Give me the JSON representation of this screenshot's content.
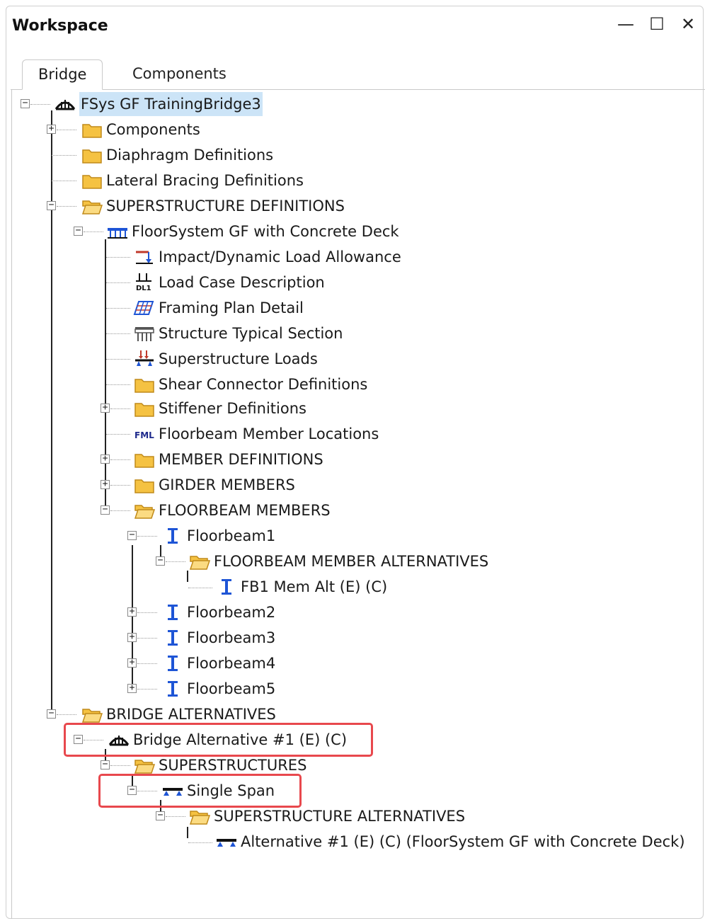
{
  "window": {
    "title": "Workspace",
    "minimize": "—",
    "maximize": "☐",
    "close": "✕"
  },
  "tabs": {
    "bridge": "Bridge",
    "components": "Components"
  },
  "tree": {
    "root": "FSys GF TrainingBridge3",
    "components": "Components",
    "diaphragm": "Diaphragm Definitions",
    "lateral": "Lateral Bracing Definitions",
    "superstructure_defs": "SUPERSTRUCTURE DEFINITIONS",
    "floorsystem": "FloorSystem GF with Concrete Deck",
    "impact": "Impact/Dynamic Load Allowance",
    "loadcase": "Load Case Description",
    "loadcase_icon_text": "DL1",
    "framing": "Framing Plan Detail",
    "typical": "Structure Typical Section",
    "superloads": "Superstructure Loads",
    "shear": "Shear Connector Definitions",
    "stiffener": "Stiffener Definitions",
    "fml_icon_text": "FML",
    "floorbeam_locations": "Floorbeam Member Locations",
    "member_defs": "MEMBER DEFINITIONS",
    "girder_members": "GIRDER MEMBERS",
    "floorbeam_members": "FLOORBEAM MEMBERS",
    "floorbeam1": "Floorbeam1",
    "fb_member_alts": "FLOORBEAM MEMBER ALTERNATIVES",
    "fb1_alt": "FB1 Mem Alt (E)  (C)",
    "floorbeam2": "Floorbeam2",
    "floorbeam3": "Floorbeam3",
    "floorbeam4": "Floorbeam4",
    "floorbeam5": "Floorbeam5",
    "bridge_alts": "BRIDGE ALTERNATIVES",
    "bridge_alt1": "Bridge Alternative #1 (E)  (C)",
    "superstructures": "SUPERSTRUCTURES",
    "single_span": "Single Span",
    "super_alts": "SUPERSTRUCTURE ALTERNATIVES",
    "alt1": "Alternative #1 (E)  (C) (FloorSystem GF with Concrete Deck)"
  },
  "colors": {
    "highlight": "#e8484d",
    "selection": "#cce4f7",
    "folder": "#f5c242",
    "member_icon": "#1e55d6"
  }
}
